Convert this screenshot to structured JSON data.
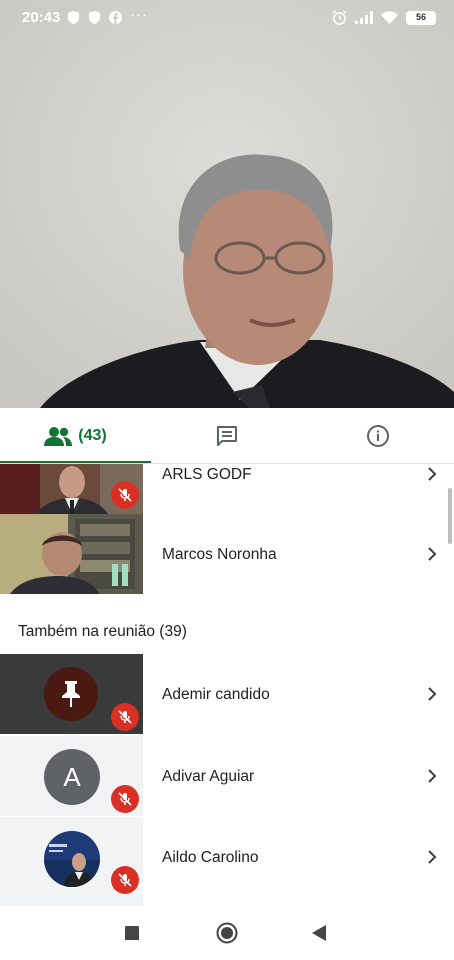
{
  "status_bar": {
    "time": "20:43",
    "battery": "56",
    "icons": [
      "shield-icon",
      "shield-icon",
      "facebook-icon",
      "more-dots-icon",
      "alarm-icon",
      "signal-icon",
      "wifi-icon",
      "battery-icon"
    ]
  },
  "tabs": [
    {
      "id": "people",
      "icon": "people-icon",
      "label": "(43)",
      "selected": true
    },
    {
      "id": "chat",
      "icon": "chat-icon",
      "label": ""
    },
    {
      "id": "info",
      "icon": "info-icon",
      "label": ""
    }
  ],
  "participants_top": [
    {
      "name": "ARLS GODF",
      "muted": true
    },
    {
      "name": "Marcos Noronha",
      "muted": false
    }
  ],
  "also_in_meeting": {
    "header": "Também na reunião (39)",
    "participants": [
      {
        "name": "Ademir candido",
        "avatar_type": "pin-icon",
        "muted": true
      },
      {
        "name": "Adivar Aguiar",
        "avatar_letter": "A",
        "muted": true
      },
      {
        "name": "Aildo Carolino",
        "avatar_type": "photo",
        "muted": true
      }
    ]
  },
  "colors": {
    "accent_green": "#137333",
    "mute_red": "#d93025",
    "avatar_grey": "#5f6368"
  },
  "nav_icons": [
    "recents-square-icon",
    "home-circle-icon",
    "back-triangle-icon"
  ]
}
